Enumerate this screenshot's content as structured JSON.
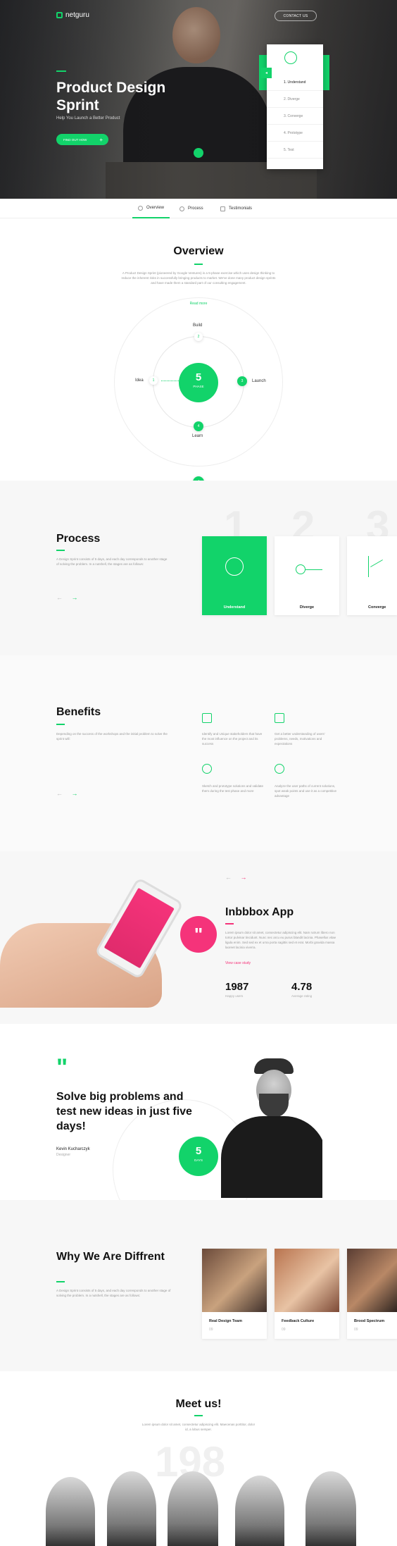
{
  "header": {
    "logo_text": "netguru",
    "contact_label": "CONTACT US"
  },
  "hero": {
    "title": "Product Design Sprint",
    "subtitle": "Help You Launch a Better Product",
    "cta_label": "FIND OUT HOW",
    "cta_icon": "plus-icon",
    "steps": [
      "1. Understand",
      "2. Diverge",
      "3. Converge",
      "4. Prototype",
      "5. Test"
    ]
  },
  "tabs": [
    {
      "label": "Overview",
      "icon": "info-icon",
      "active": true
    },
    {
      "label": "Process",
      "icon": "gear-icon",
      "active": false
    },
    {
      "label": "Testimonials",
      "icon": "chat-icon",
      "active": false
    }
  ],
  "overview": {
    "title": "Overview",
    "body": "A Product Design Sprint (pioneered by Google Ventures) is a 5-phase exercise which uses design thinking to reduce the inherent risks in successfully bringing products to market. We've done many product design sprints and have made them a standard part of our consulting engagement.",
    "link": "Read more",
    "center_number": "5",
    "center_label": "PHASE",
    "nodes": [
      {
        "num": "1",
        "label": "Idea"
      },
      {
        "num": "2",
        "label": "Build"
      },
      {
        "num": "3",
        "label": "Launch"
      },
      {
        "num": "4",
        "label": "Learn"
      }
    ],
    "bottom_badge": "4"
  },
  "process": {
    "title": "Process",
    "body": "A Design Sprint consists of 5 days, and each day corresponds to another stage of solving the problem. In a nutshell, the stages are as follows:",
    "big_numbers": [
      "1",
      "2",
      "3"
    ],
    "cards": [
      {
        "label": "Understand",
        "icon": "target-icon",
        "active": true
      },
      {
        "label": "Diverge",
        "icon": "diverge-icon",
        "active": false
      },
      {
        "label": "Converge",
        "icon": "converge-icon",
        "active": false
      }
    ]
  },
  "benefits": {
    "title": "Benefits",
    "body": "Depending on the success of the workshops and the initial problem to solve the sprint will:",
    "items": [
      {
        "icon": "clipboard-icon",
        "text": "Identify and Unique stakeholders that have the most influence on the project and its success"
      },
      {
        "icon": "folder-icon",
        "text": "Get a better understanding of users' problems, needs, motivations and expectations"
      },
      {
        "icon": "lightbulb-icon",
        "text": "Sketch and prototype solutions and validate them during the test phase and more"
      },
      {
        "icon": "pie-chart-icon",
        "text": "Analyze the user paths of current solutions, spot weak points and use it as a competitive advantage"
      }
    ]
  },
  "app": {
    "title": "Inbbbox App",
    "body": "Lorem ipsum dolor sit amet, consectetur adipiscing elit. Nam rutrum libero non tortor pulvinar tincidunt. Nunc nec arcu eu purus blandit lacinia. Phasellus vitae ligula enim. Sed sed ex et urna porta sagittis sed et erat. Morbi gravida massa laoreet lacinia viverra.",
    "link": "View case study",
    "stats": [
      {
        "value": "1987",
        "label": "Happy users"
      },
      {
        "value": "4.78",
        "label": "Average rating"
      }
    ]
  },
  "testimonial": {
    "quote": "Solve big problems and test new ideas in just five days!",
    "author": "Kevin Kucharczyk",
    "role": "Designer",
    "badge_number": "5",
    "badge_label": "DAYS"
  },
  "why": {
    "title": "Why We Are Diffrent",
    "body": "A Design Sprint consists of 5 days, and each day corresponds to another stage of solving the problem. In a nutshell, the stages are as follows:",
    "cards": [
      {
        "title": "Real Design Team",
        "meta": "09"
      },
      {
        "title": "Feedback Culture",
        "meta": "09"
      },
      {
        "title": "Brood Spectrum",
        "meta": "09"
      }
    ]
  },
  "meet": {
    "title": "Meet us!",
    "body": "Lorem ipsum dolor sit amet, consectetur adipiscing elit. Maecenas porttitor, dolor id, a lobus semper.",
    "bg_number": "198"
  }
}
